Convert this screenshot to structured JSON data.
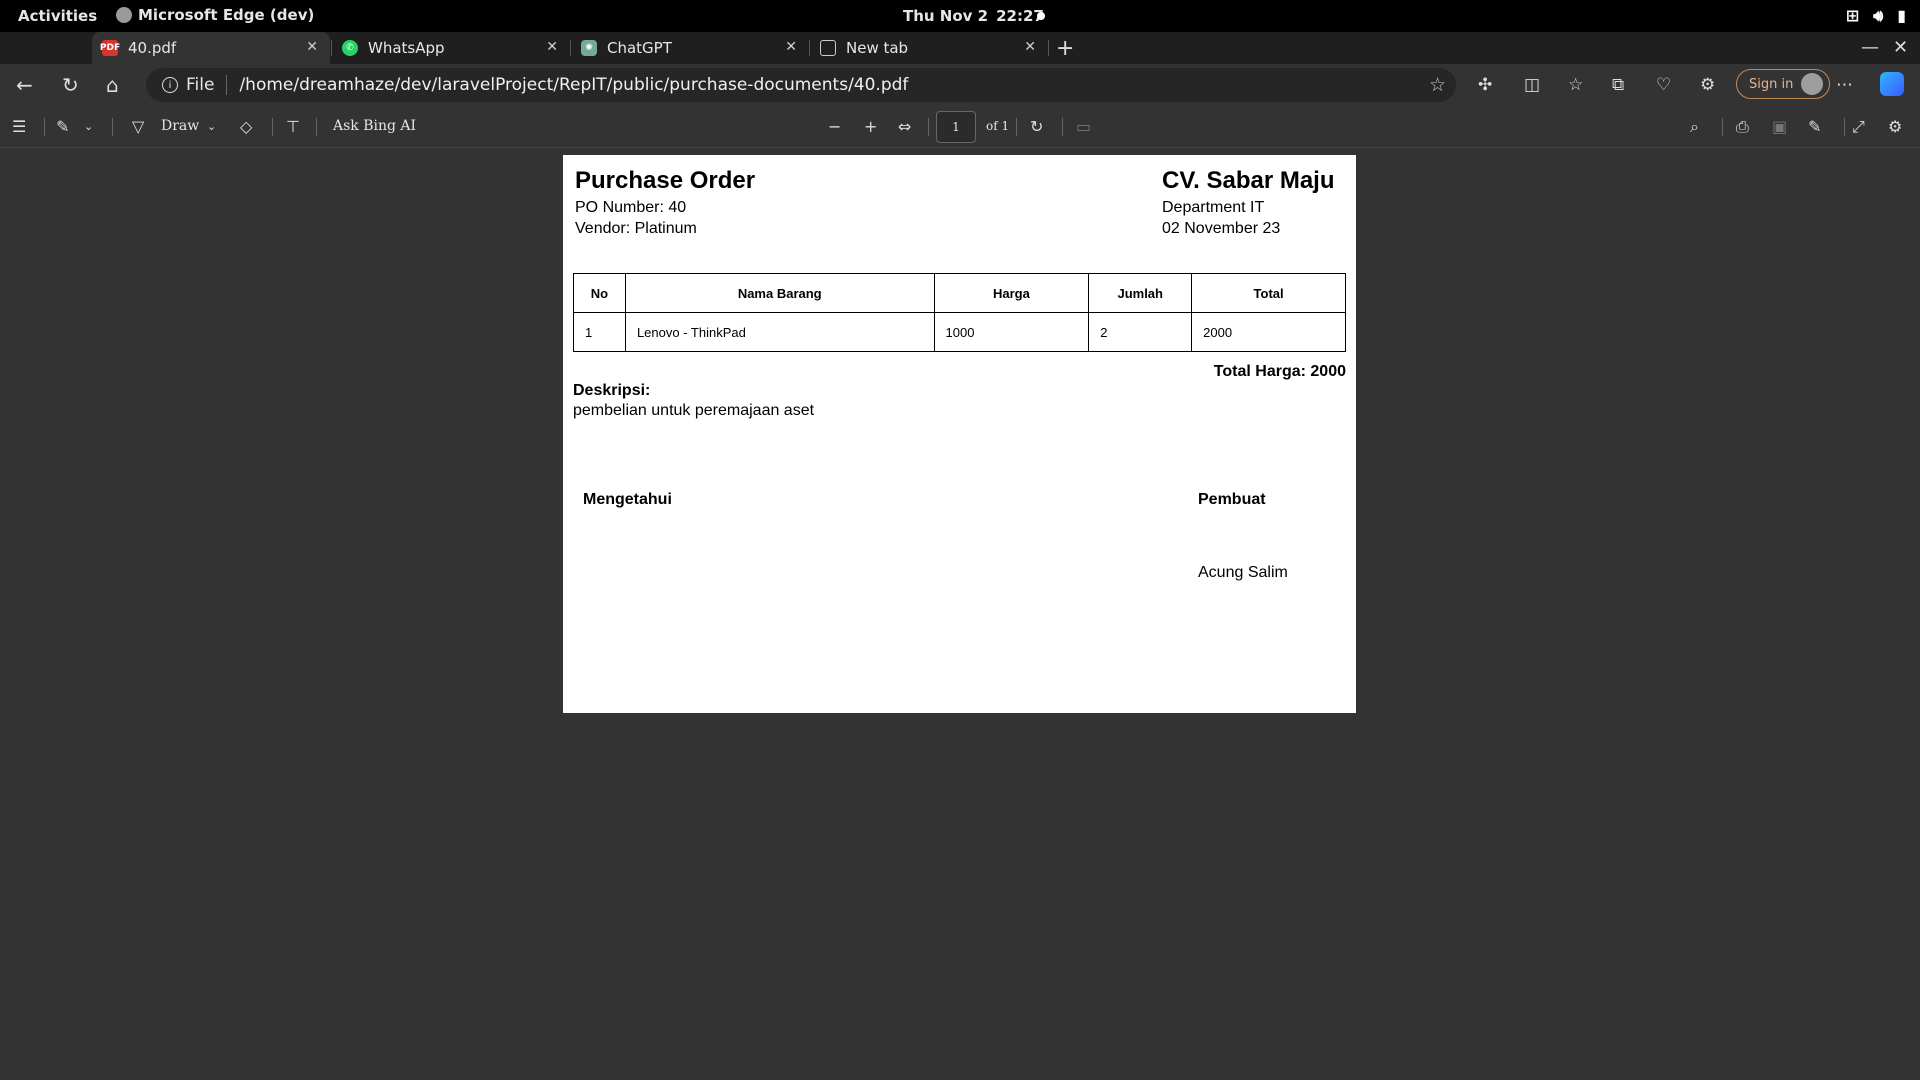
{
  "system": {
    "activities": "Activities",
    "app_name": "Microsoft Edge (dev)",
    "date": "Thu Nov 2",
    "time": "22:27"
  },
  "tabs": [
    {
      "label": "40.pdf",
      "icon": "pdf-icon",
      "active": true
    },
    {
      "label": "WhatsApp",
      "icon": "whatsapp-icon",
      "active": false
    },
    {
      "label": "ChatGPT",
      "icon": "chatgpt-icon",
      "active": false
    },
    {
      "label": "New tab",
      "icon": "newtab-icon",
      "active": false
    }
  ],
  "address": {
    "scheme": "File",
    "url": "/home/dreamhaze/dev/laravelProject/RepIT/public/purchase-documents/40.pdf",
    "signin_label": "Sign in"
  },
  "pdf_toolbar": {
    "draw_label": "Draw",
    "ask_bing_label": "Ask Bing AI",
    "page_value": "1",
    "page_of": "of 1"
  },
  "document": {
    "title": "Purchase Order",
    "po_number": "PO Number: 40",
    "vendor": "Vendor: Platinum",
    "company": "CV. Sabar Maju",
    "department": "Department IT",
    "date": "02 November 23",
    "table": {
      "headers": [
        "No",
        "Nama Barang",
        "Harga",
        "Jumlah",
        "Total"
      ],
      "rows": [
        [
          "1",
          "Lenovo - ThinkPad",
          "1000",
          "2",
          "2000"
        ]
      ]
    },
    "total": "Total Harga: 2000",
    "description_label": "Deskripsi:",
    "description": "pembelian untuk peremajaan aset",
    "sign_left_label": "Mengetahui",
    "sign_right_label": "Pembuat",
    "sign_right_name": "Acung Salim"
  },
  "colors": {
    "chrome_bg": "#333333",
    "tabstrip_bg": "#1f1f1f",
    "page_bg": "#ffffff",
    "signin_accent": "#e8b48e"
  }
}
